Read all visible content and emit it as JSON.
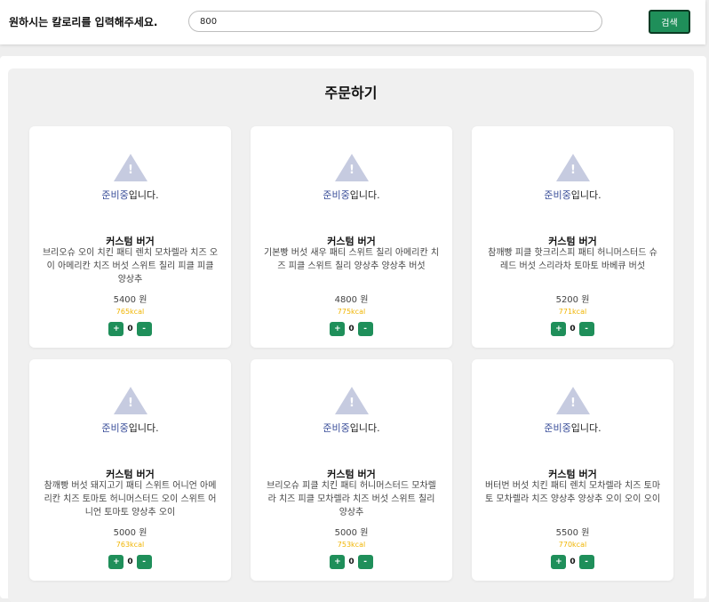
{
  "header": {
    "prompt": "원하시는 칼로리를 입력해주세요.",
    "search_value": "800",
    "search_button": "검색"
  },
  "order": {
    "title": "주문하기",
    "cards": [
      {
        "image_status_highlight": "준비중",
        "image_status_rest": "입니다.",
        "name": "커스텀 버거",
        "description": "브리오슈 오이 치킨 패티 렌치 모차렐라 치즈 오이 아메리칸 치즈 버섯 스위트 칠리 피클 피클 양상추",
        "price": "5400 원",
        "kcal": "765kcal",
        "plus": "+",
        "quantity": "0",
        "minus": "-"
      },
      {
        "image_status_highlight": "준비중",
        "image_status_rest": "입니다.",
        "name": "커스텀 버거",
        "description": "기본빵 버섯 새우 패티 스위트 칠리 아메리칸 치즈 피클 스위트 칠리 양상추 양상추 버섯",
        "price": "4800 원",
        "kcal": "775kcal",
        "plus": "+",
        "quantity": "0",
        "minus": "-"
      },
      {
        "image_status_highlight": "준비중",
        "image_status_rest": "입니다.",
        "name": "커스텀 버거",
        "description": "참깨빵 피클 핫크리스피 패티 허니머스터드 슈레드 버섯 스리라차 토마토 바베큐 버섯",
        "price": "5200 원",
        "kcal": "771kcal",
        "plus": "+",
        "quantity": "0",
        "minus": "-"
      },
      {
        "image_status_highlight": "준비중",
        "image_status_rest": "입니다.",
        "name": "커스텀 버거",
        "description": "참깨빵 버섯 돼지고기 패티 스위트 어니언 아메리칸 치즈 토마토 허니머스터드 오이 스위트 어니언 토마토 양상추 오이",
        "price": "5000 원",
        "kcal": "763kcal",
        "plus": "+",
        "quantity": "0",
        "minus": "-"
      },
      {
        "image_status_highlight": "준비중",
        "image_status_rest": "입니다.",
        "name": "커스텀 버거",
        "description": "브리오슈 피클 치킨 패티 허니머스터드 모차렐라 치즈 피클 모차렐라 치즈 버섯 스위트 칠리 양상추",
        "price": "5000 원",
        "kcal": "753kcal",
        "plus": "+",
        "quantity": "0",
        "minus": "-"
      },
      {
        "image_status_highlight": "준비중",
        "image_status_rest": "입니다.",
        "name": "커스텀 버거",
        "description": "버터번 버섯 치킨 패티 렌치 모차렐라 치즈 토마토 모차렐라 치즈 양상추 양상추 오이 오이 오이",
        "price": "5500 원",
        "kcal": "770kcal",
        "plus": "+",
        "quantity": "0",
        "minus": "-"
      }
    ]
  }
}
